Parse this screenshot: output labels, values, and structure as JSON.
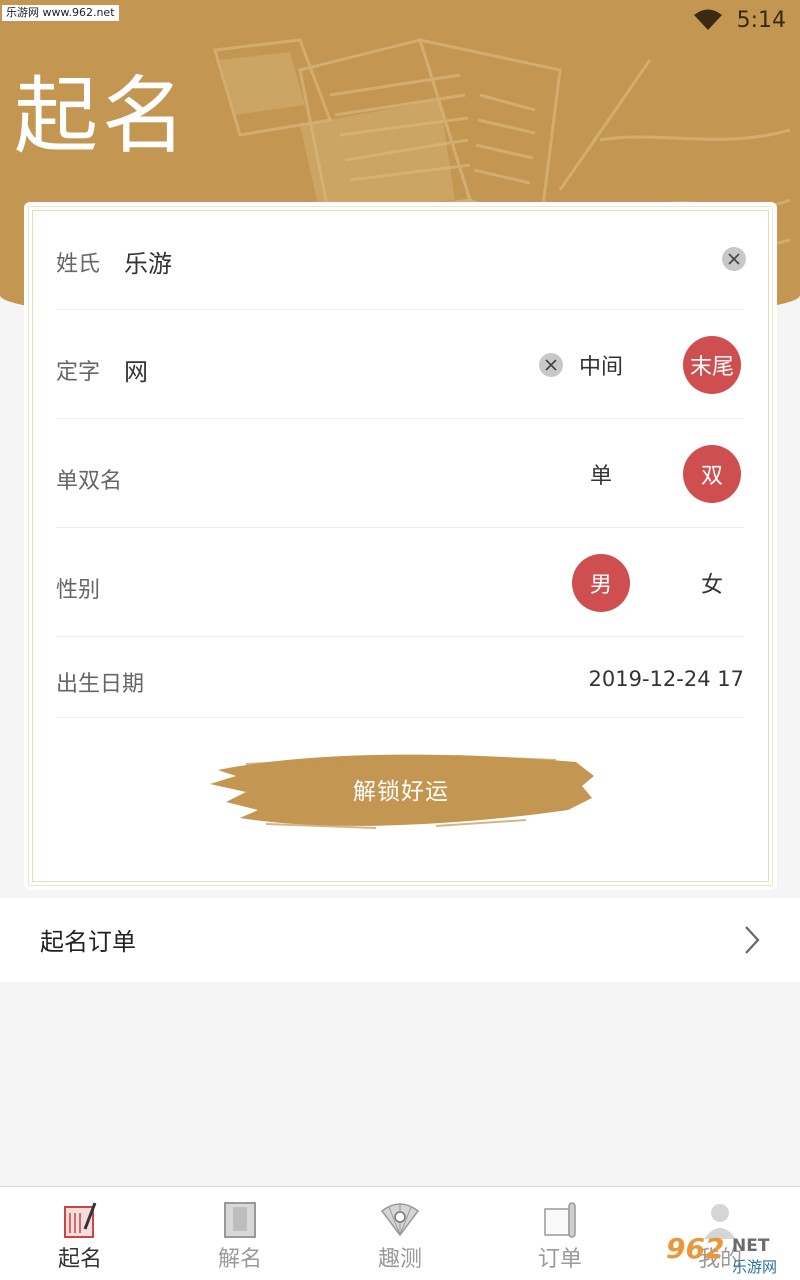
{
  "watermark": {
    "top_left": "乐游网 www.962.net",
    "bottom_right_num": "962",
    "bottom_right_net": "NET",
    "bottom_right_cn": "乐游网"
  },
  "status_bar": {
    "time": "5:14",
    "wifi_icon": "wifi-icon"
  },
  "header": {
    "title": "起名"
  },
  "form": {
    "surname": {
      "label": "姓氏",
      "value": "乐游"
    },
    "fixed_char": {
      "label": "定字",
      "value": "网",
      "options": [
        "中间",
        "末尾"
      ],
      "selected": "末尾"
    },
    "name_length": {
      "label": "单双名",
      "options": [
        "单",
        "双"
      ],
      "selected": "双"
    },
    "gender": {
      "label": "性别",
      "options": [
        "男",
        "女"
      ],
      "selected": "男"
    },
    "birth_date": {
      "label": "出生日期",
      "value": "2019-12-24 17"
    },
    "submit_label": "解锁好运"
  },
  "orders": {
    "label": "起名订单"
  },
  "bottom_nav": {
    "items": [
      {
        "label": "起名",
        "icon": "naming-scroll-icon",
        "active": true
      },
      {
        "label": "解名",
        "icon": "book-icon",
        "active": false
      },
      {
        "label": "趣测",
        "icon": "fan-icon",
        "active": false
      },
      {
        "label": "订单",
        "icon": "scroll-icon",
        "active": false
      },
      {
        "label": "我的",
        "icon": "profile-icon",
        "active": false
      }
    ]
  },
  "colors": {
    "header": "#c39651",
    "selected": "#cf4e4f",
    "brush": "#c39651"
  }
}
